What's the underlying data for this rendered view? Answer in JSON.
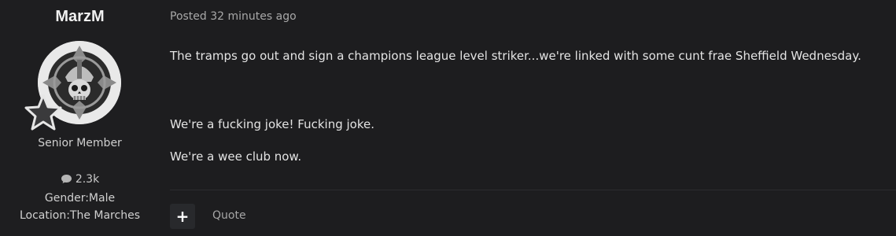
{
  "author": {
    "username": "MarzM",
    "role": "Senior Member",
    "posts_count": "2.3k",
    "gender_line": "Gender:Male",
    "location_line": "Location:The Marches",
    "icons": {
      "avatar": "skull-cross-avatar",
      "badge": "star-icon",
      "posts": "speech-bubble-icon"
    }
  },
  "post": {
    "posted": "Posted 32 minutes ago",
    "paragraphs": [
      "The tramps go out and sign a champions league level striker...we're linked with some cunt frae Sheffield Wednesday.",
      "We're a fucking joke! Fucking joke.",
      "We're a wee club now."
    ]
  },
  "actions": {
    "plus_label": "+",
    "quote_label": "Quote"
  },
  "colors": {
    "background": "#1d1d1f",
    "text": "#e4e4e4",
    "muted": "#a8a8a8"
  }
}
